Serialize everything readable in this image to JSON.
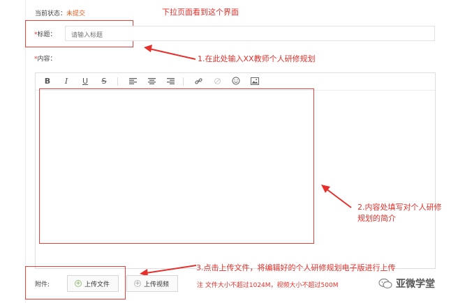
{
  "status": {
    "label": "当前状态：",
    "value": "未提交"
  },
  "title_field": {
    "required_mark": "*",
    "label": "标题：",
    "placeholder": "请输入标题"
  },
  "content_field": {
    "required_mark": "*",
    "label": "内容："
  },
  "toolbar": {
    "bold": "B",
    "italic": "I",
    "underline": "U",
    "strike": "S"
  },
  "attachments": {
    "label": "附件:",
    "upload_file_label": "上传文件",
    "upload_video_label": "上传视频",
    "note": "注 文件大小不超过1024M，视频大小不超过500M"
  },
  "annotations": {
    "top": "下拉页面看到这个界面",
    "step1": "1.在此处输入XX教师个人研修规划",
    "step2_line1": "2.内容处填写对个人研修",
    "step2_line2": "规划的简介",
    "step3": "3.点击上传文件，将编辑好的个人研修规划电子版进行上传"
  },
  "watermark": {
    "text": "亚微学堂",
    "icon": "wechat-icon"
  },
  "colors": {
    "annotation_red": "#e5302b",
    "status_orange": "#e8591a"
  }
}
